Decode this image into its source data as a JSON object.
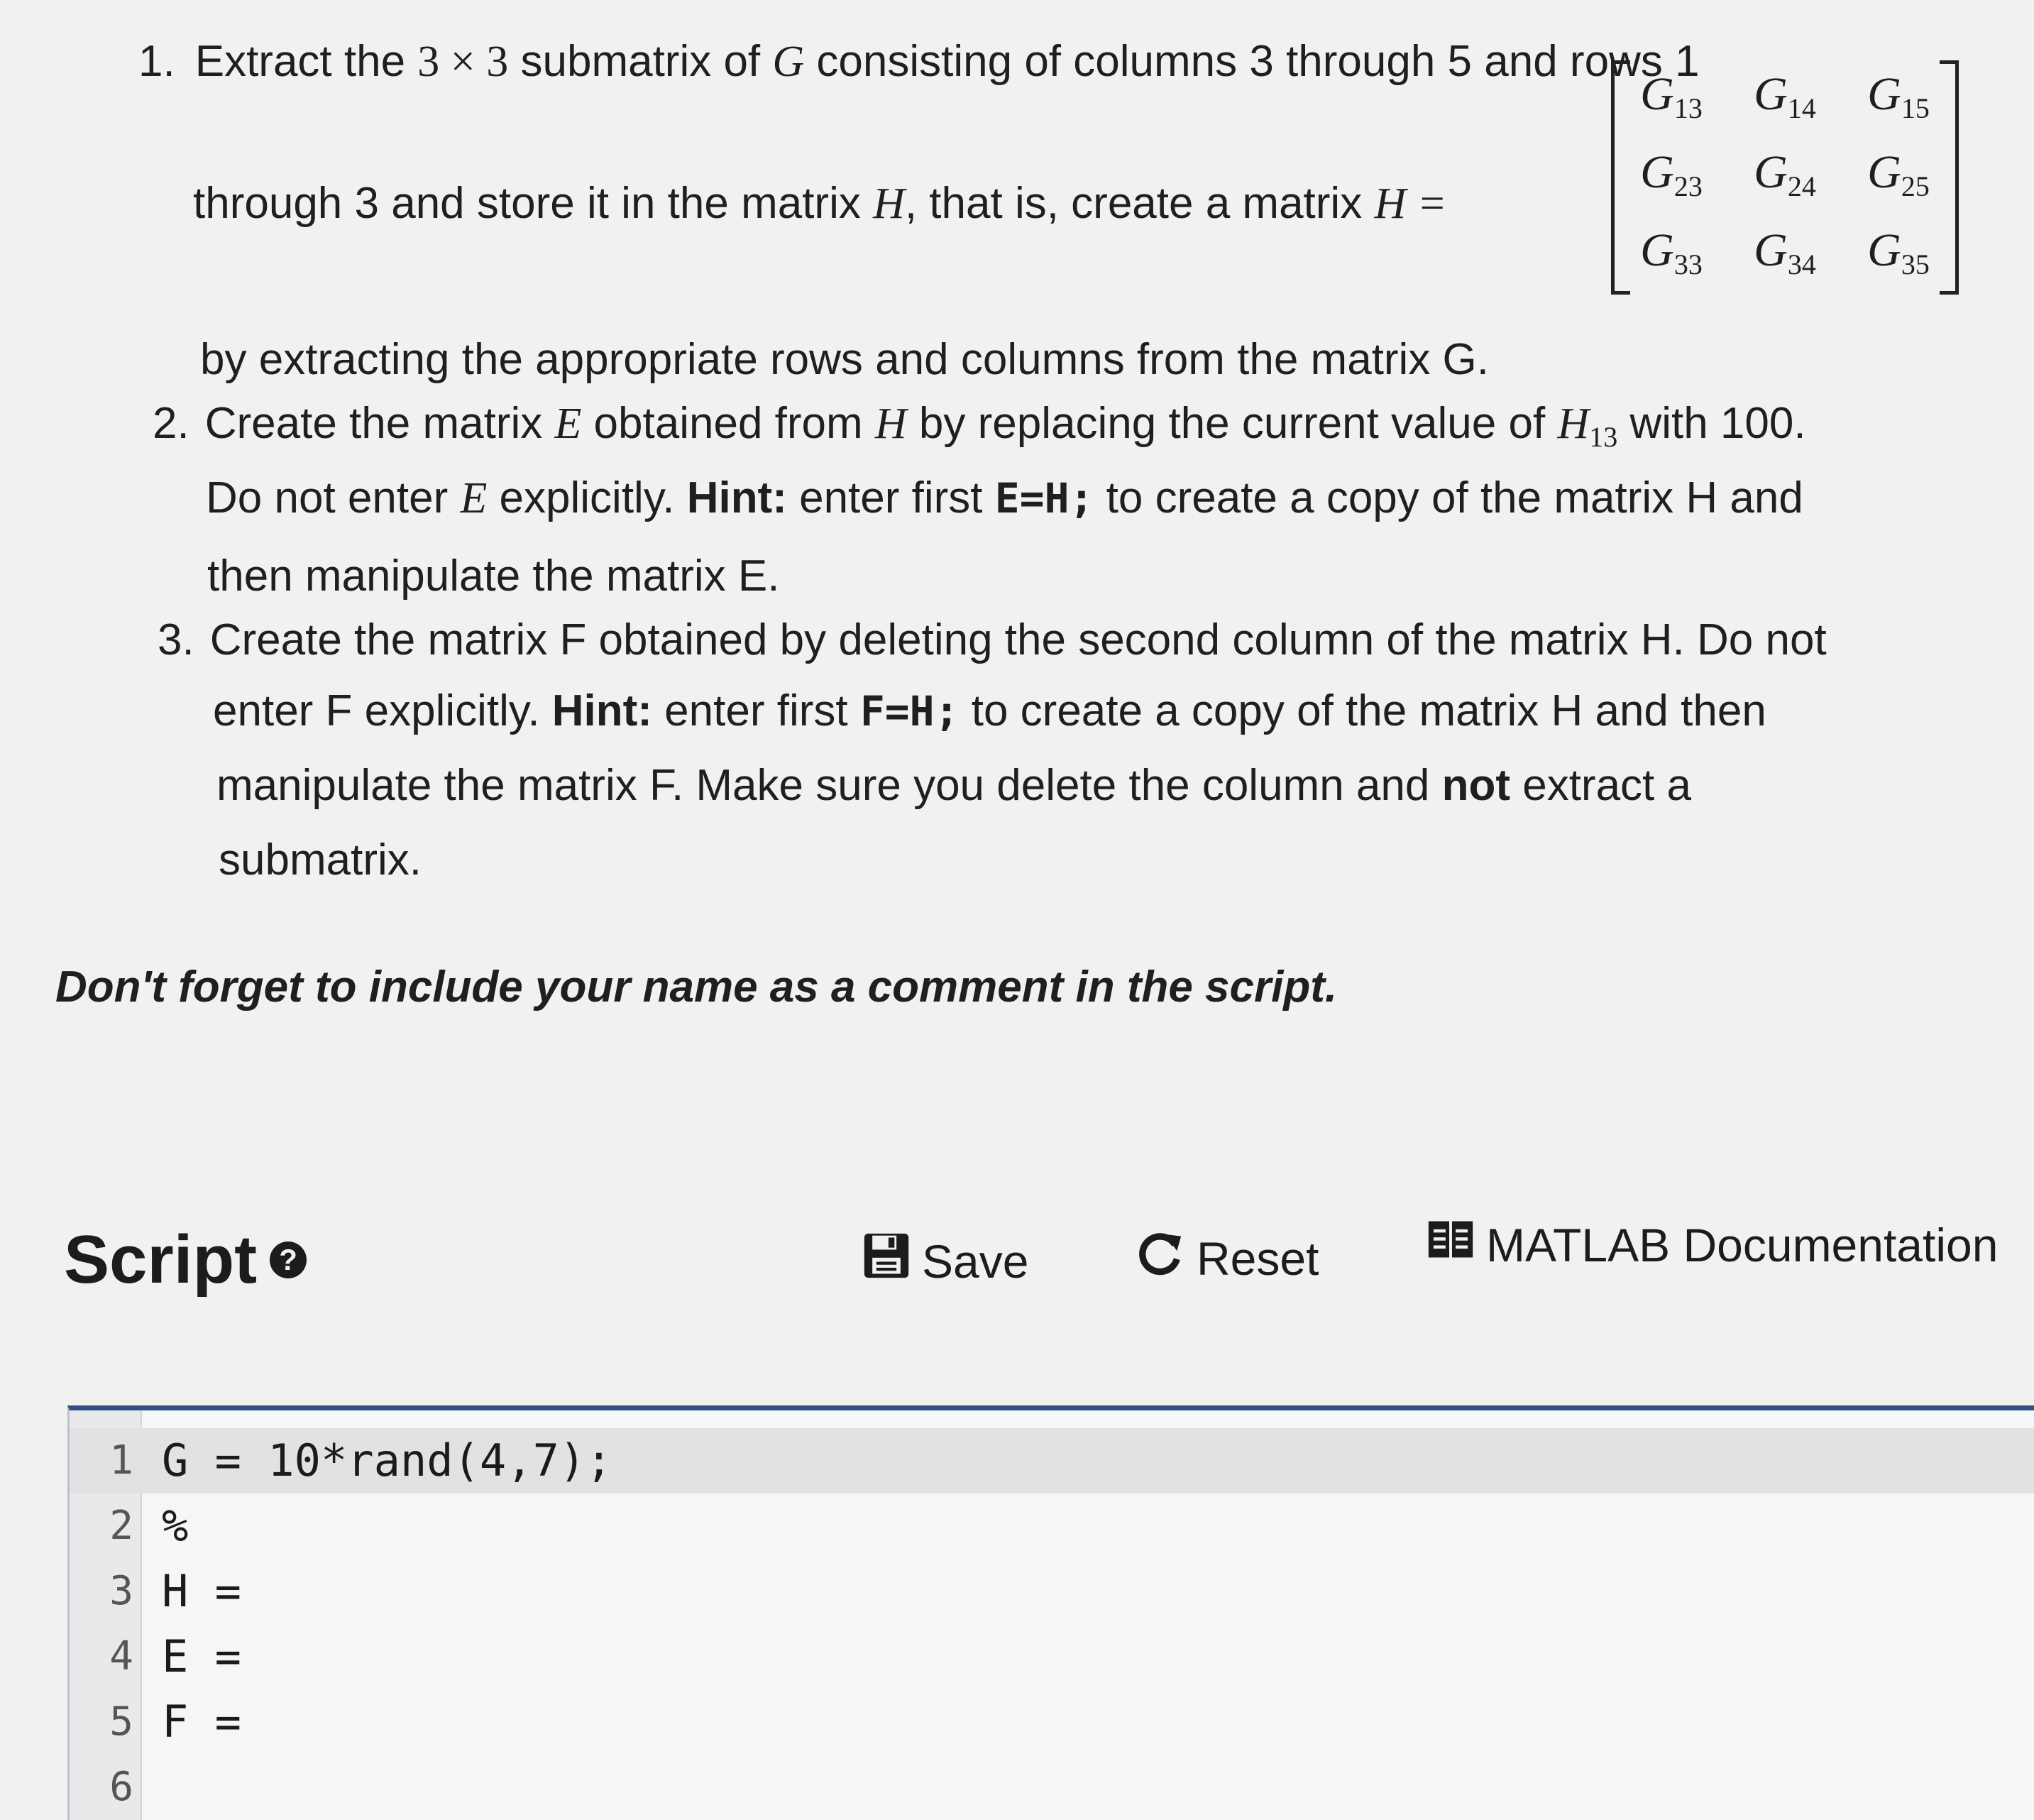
{
  "instructions": {
    "item1": {
      "number": "1.",
      "line1_a": "Extract the ",
      "line1_size": "3 × 3",
      "line1_b": " submatrix of ",
      "line1_var": "G",
      "line1_c": " consisting of columns 3 through 5 and rows 1",
      "line2_a": "through 3 and store it in the matrix ",
      "line2_var": "H",
      "line2_b": ", that is, create a matrix ",
      "line2_eq": "H =",
      "line3": "by extracting the appropriate rows and columns from the matrix G."
    },
    "matrix": {
      "var": "G",
      "cells": [
        [
          "13",
          "14",
          "15"
        ],
        [
          "23",
          "24",
          "25"
        ],
        [
          "33",
          "34",
          "35"
        ]
      ]
    },
    "item2": {
      "number": "2.",
      "l1_a": "Create the matrix ",
      "l1_var": "E",
      "l1_b": " obtained from ",
      "l1_var2": "H",
      "l1_c": " by replacing the current value of ",
      "l1_var3": "H",
      "l1_sub": "13",
      "l1_d": " with 100.",
      "l2_a": "Do not enter ",
      "l2_var": "E",
      "l2_b": " explicitly. ",
      "l2_hint": "Hint:",
      "l2_c": " enter first ",
      "l2_code": "E=H;",
      "l2_d": " to create a copy of the matrix H and",
      "l3": "then manipulate the matrix E."
    },
    "item3": {
      "number": "3.",
      "l1": "Create the matrix F obtained by deleting the second column of the matrix H. Do not",
      "l2_a": "enter F explicitly. ",
      "l2_hint": "Hint:",
      "l2_b": " enter first ",
      "l2_code": "F=H;",
      "l2_c": " to create a copy of the matrix H and then",
      "l3_a": "manipulate the matrix F. Make sure you delete the column and ",
      "l3_not": "not",
      "l3_b": " extract a",
      "l4": "submatrix."
    },
    "reminder": "Don't forget to include your name as a comment in the script."
  },
  "toolbar": {
    "title": "Script",
    "help_icon": "question-circle-icon",
    "save_label": "Save",
    "save_icon": "floppy-disk-icon",
    "reset_label": "Reset",
    "reset_icon": "reset-arrow-icon",
    "docs_label": "MATLAB Documentation",
    "docs_icon": "book-icon"
  },
  "editor": {
    "lines": [
      {
        "n": "1",
        "code": "G = 10*rand(4,7);"
      },
      {
        "n": "2",
        "code": "%"
      },
      {
        "n": "3",
        "code": "H ="
      },
      {
        "n": "4",
        "code": "E ="
      },
      {
        "n": "5",
        "code": "F ="
      },
      {
        "n": "6",
        "code": ""
      }
    ]
  },
  "colors": {
    "editor_border": "#2f4f86",
    "background": "#f1f1ef"
  }
}
